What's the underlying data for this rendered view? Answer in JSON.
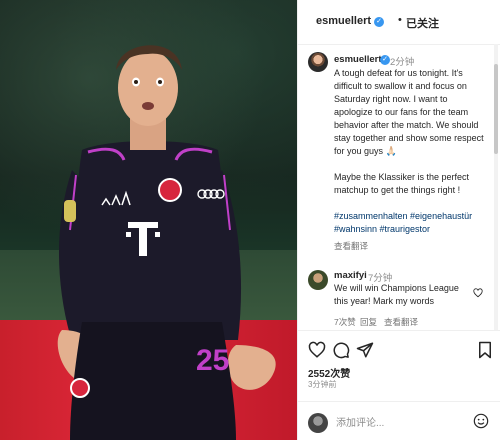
{
  "post": {
    "username": "esmuellert",
    "follow_label": "已关注",
    "header_dot": "•"
  },
  "caption": {
    "username": "esmuellert",
    "time": "2分钟",
    "text1": "A tough defeat for us tonight. It's difficult to swallow it and focus on Saturday right now. I want to apologize to our fans for the team behavior after the match. We should stay together and show some respect for you guys 🙏🏻",
    "text2": "Maybe the Klassiker is the perfect matchup to get the things right !",
    "hashtags": "#zusammenhalten #eigenehaustür #wahnsinn #traurigestor",
    "translate": "查看翻译"
  },
  "comment": {
    "username": "maxifyi",
    "time": "7分钟",
    "text": "We will win Champions League this year! Mark my words",
    "likes": "7次赞",
    "reply": "回复",
    "translate": "查看翻译"
  },
  "stats": {
    "likes": "2552次赞",
    "ago": "3分钟前"
  },
  "add_comment": {
    "placeholder": "添加评论..."
  },
  "photo": {
    "jersey_number": "25",
    "sponsor": "T",
    "badge_text": "FC BAYERN",
    "audi": "audi"
  },
  "colors": {
    "verified": "#3897f0",
    "hashtag": "#00376b",
    "jersey": "#1c1a2a",
    "trim": "#c040c8"
  }
}
